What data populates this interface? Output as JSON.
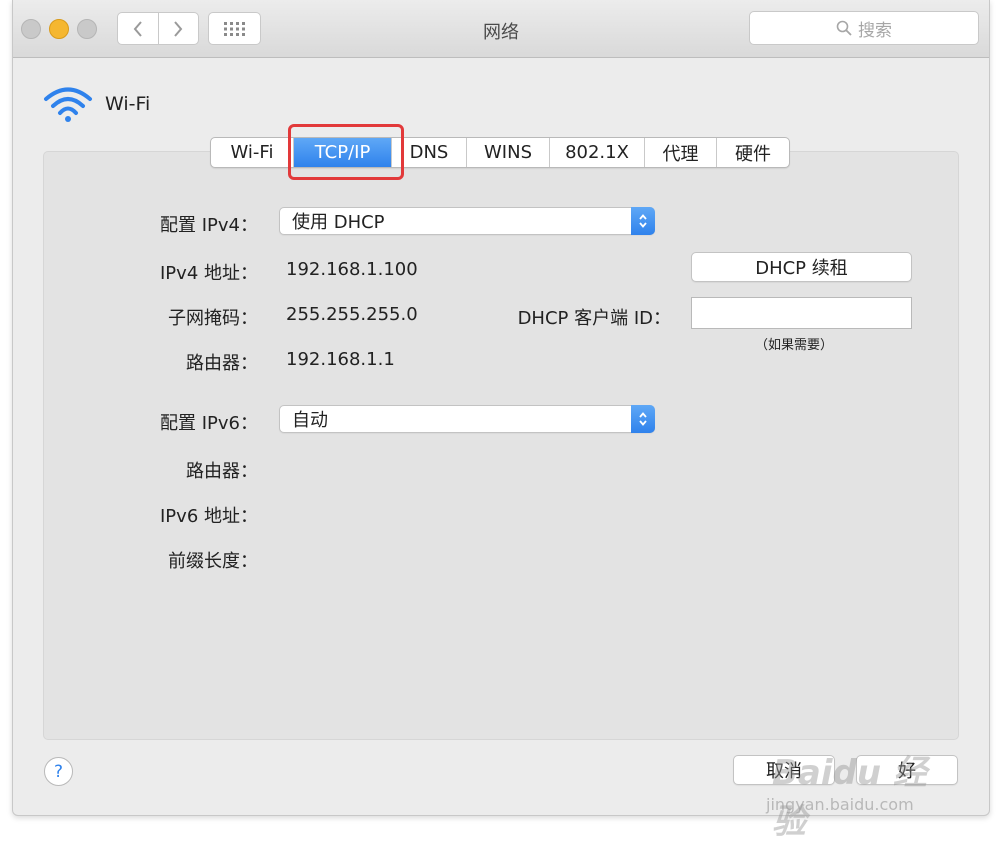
{
  "window": {
    "title": "网络",
    "search_placeholder": "搜索"
  },
  "service": {
    "name": "Wi-Fi"
  },
  "tabs": [
    {
      "label": "Wi-Fi",
      "active": false
    },
    {
      "label": "TCP/IP",
      "active": true
    },
    {
      "label": "DNS",
      "active": false
    },
    {
      "label": "WINS",
      "active": false
    },
    {
      "label": "802.1X",
      "active": false
    },
    {
      "label": "代理",
      "active": false
    },
    {
      "label": "硬件",
      "active": false
    }
  ],
  "ipv4": {
    "config_label": "配置 IPv4：",
    "config_value": "使用 DHCP",
    "address_label": "IPv4 地址：",
    "address_value": "192.168.1.100",
    "subnet_label": "子网掩码：",
    "subnet_value": "255.255.255.0",
    "router_label": "路由器：",
    "router_value": "192.168.1.1",
    "renew_button": "DHCP 续租",
    "client_id_label": "DHCP 客户端 ID：",
    "client_id_value": "",
    "client_id_hint": "（如果需要）"
  },
  "ipv6": {
    "config_label": "配置 IPv6：",
    "config_value": "自动",
    "router_label": "路由器：",
    "address_label": "IPv6 地址：",
    "prefix_label": "前缀长度："
  },
  "footer": {
    "help": "?",
    "cancel": "取消",
    "ok": "好"
  },
  "watermark": {
    "logo": "Baidu 经验",
    "url": "jingyan.baidu.com"
  },
  "colors": {
    "accent": "#2f82ec",
    "highlight_box": "#e2393a",
    "minimize": "#f5b731"
  }
}
